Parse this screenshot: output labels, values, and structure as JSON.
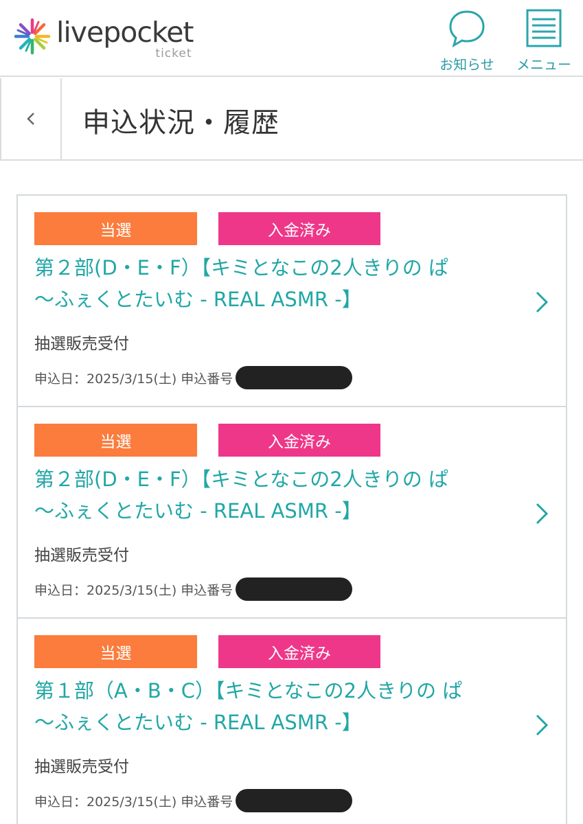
{
  "header": {
    "logo_word": "livepocket",
    "logo_sub": "ticket",
    "news_label": "お知らせ",
    "menu_label": "メニュー"
  },
  "subheader": {
    "title": "申込状況・履歴"
  },
  "colors": {
    "accent": "#21a7a6",
    "badge_win": "#fb7c3c",
    "badge_paid": "#ee3789",
    "border": "#d4d9dc"
  },
  "entries": [
    {
      "badge_win": "当選",
      "badge_paid": "入金済み",
      "title_line1": "第２部(D・E・F）【キミとなこの2人きりの ぱ",
      "title_line2": "〜ふぇくとたいむ - REAL ASMR -】",
      "sale_type": "抽選販売受付",
      "applied_label": "申込日：2025/3/15(土) 申込番号"
    },
    {
      "badge_win": "当選",
      "badge_paid": "入金済み",
      "title_line1": "第２部(D・E・F）【キミとなこの2人きりの ぱ",
      "title_line2": "〜ふぇくとたいむ - REAL ASMR -】",
      "sale_type": "抽選販売受付",
      "applied_label": "申込日：2025/3/15(土) 申込番号"
    },
    {
      "badge_win": "当選",
      "badge_paid": "入金済み",
      "title_line1": "第１部（A・B・C）【キミとなこの2人きりの ぱ",
      "title_line2": "〜ふぇくとたいむ - REAL ASMR -】",
      "sale_type": "抽選販売受付",
      "applied_label": "申込日：2025/3/15(土) 申込番号"
    }
  ]
}
